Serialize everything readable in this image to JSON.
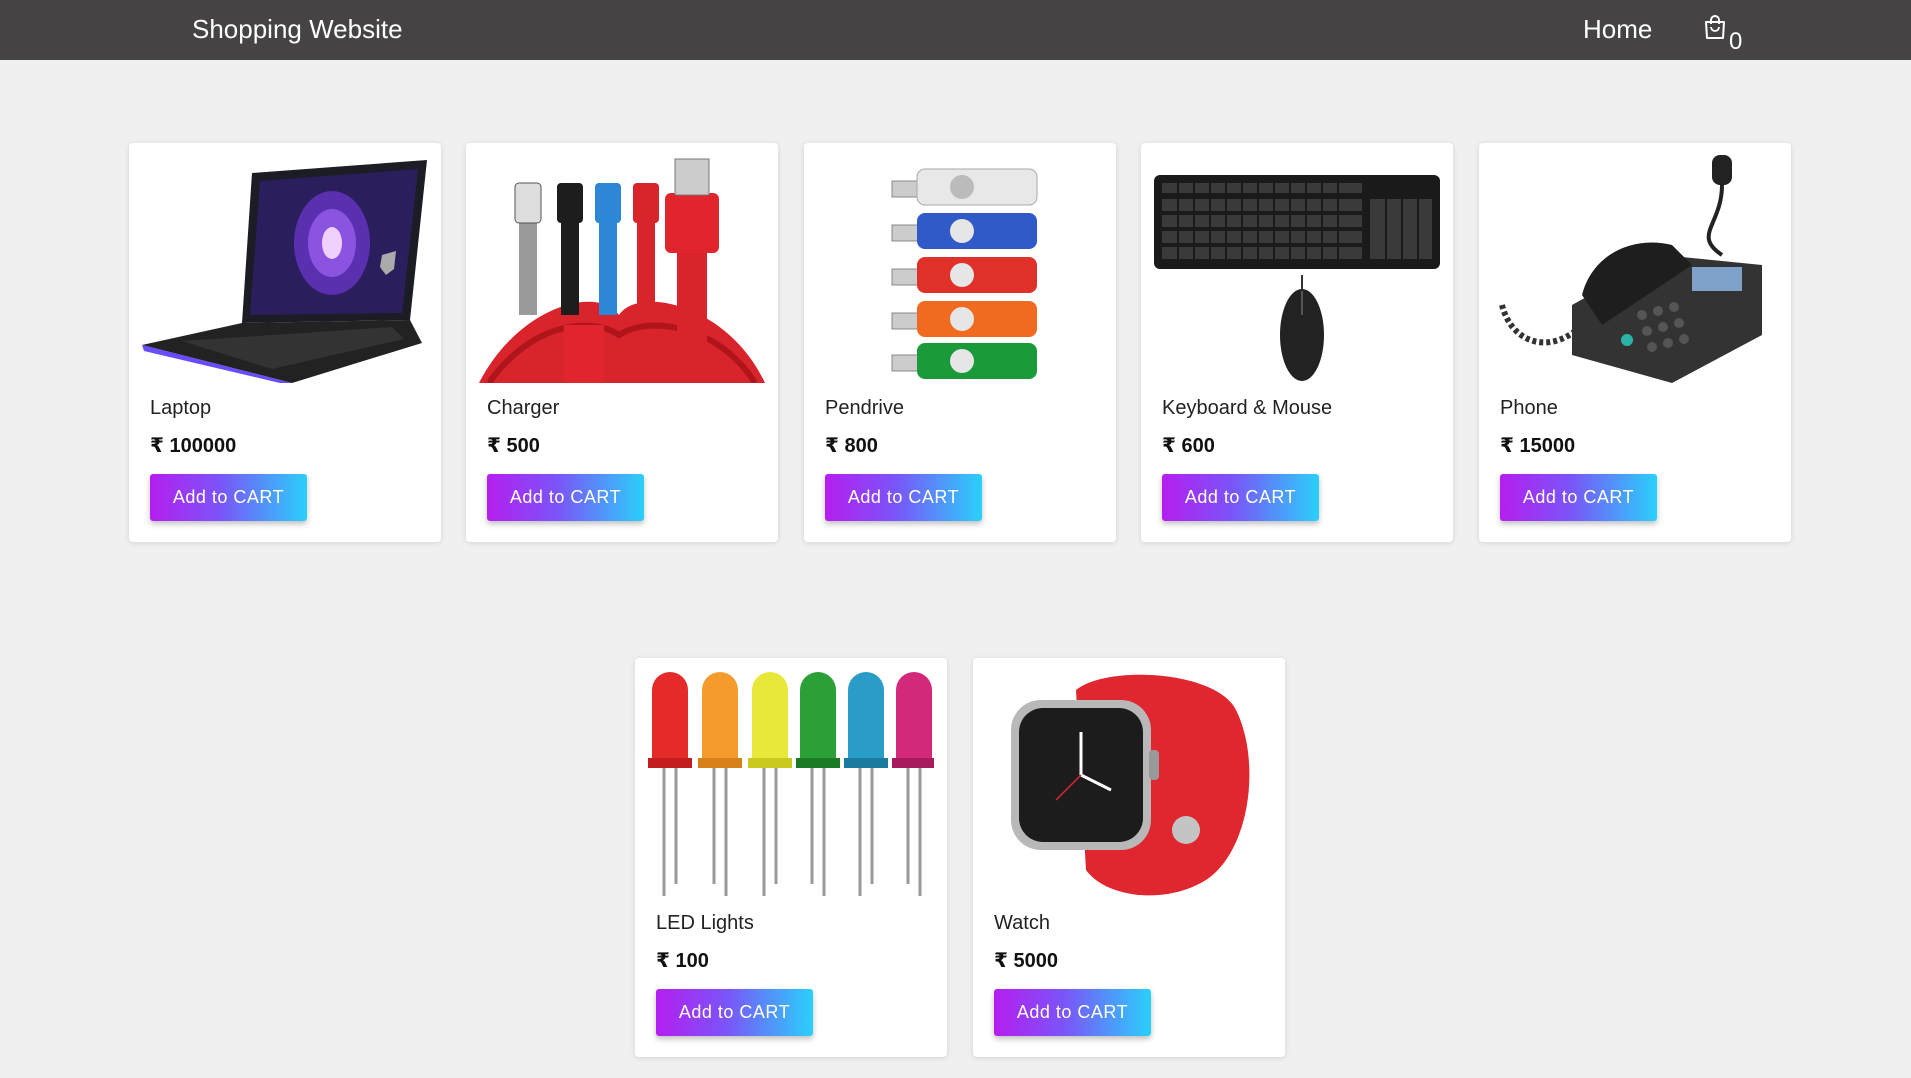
{
  "nav": {
    "brand": "Shopping Website",
    "home": "Home",
    "cart_count": "0"
  },
  "products": [
    {
      "name": "Laptop",
      "price": "₹ 100000",
      "button": "Add to CART",
      "icon": "laptop-image"
    },
    {
      "name": "Charger",
      "price": "₹ 500",
      "button": "Add to CART",
      "icon": "charger-image"
    },
    {
      "name": "Pendrive",
      "price": "₹ 800",
      "button": "Add to CART",
      "icon": "pendrive-image"
    },
    {
      "name": "Keyboard & Mouse",
      "price": "₹ 600",
      "button": "Add to CART",
      "icon": "keyboard-mouse-image"
    },
    {
      "name": "Phone",
      "price": "₹ 15000",
      "button": "Add to CART",
      "icon": "phone-image"
    },
    {
      "name": "LED Lights",
      "price": "₹ 100",
      "button": "Add to CART",
      "icon": "led-lights-image"
    },
    {
      "name": "Watch",
      "price": "₹ 5000",
      "button": "Add to CART",
      "icon": "watch-image"
    }
  ],
  "colors": {
    "navbar": "#454343",
    "background": "#f0f0f0",
    "button_gradient_start": "#b51ef0",
    "button_gradient_end": "#2ad0fb"
  }
}
